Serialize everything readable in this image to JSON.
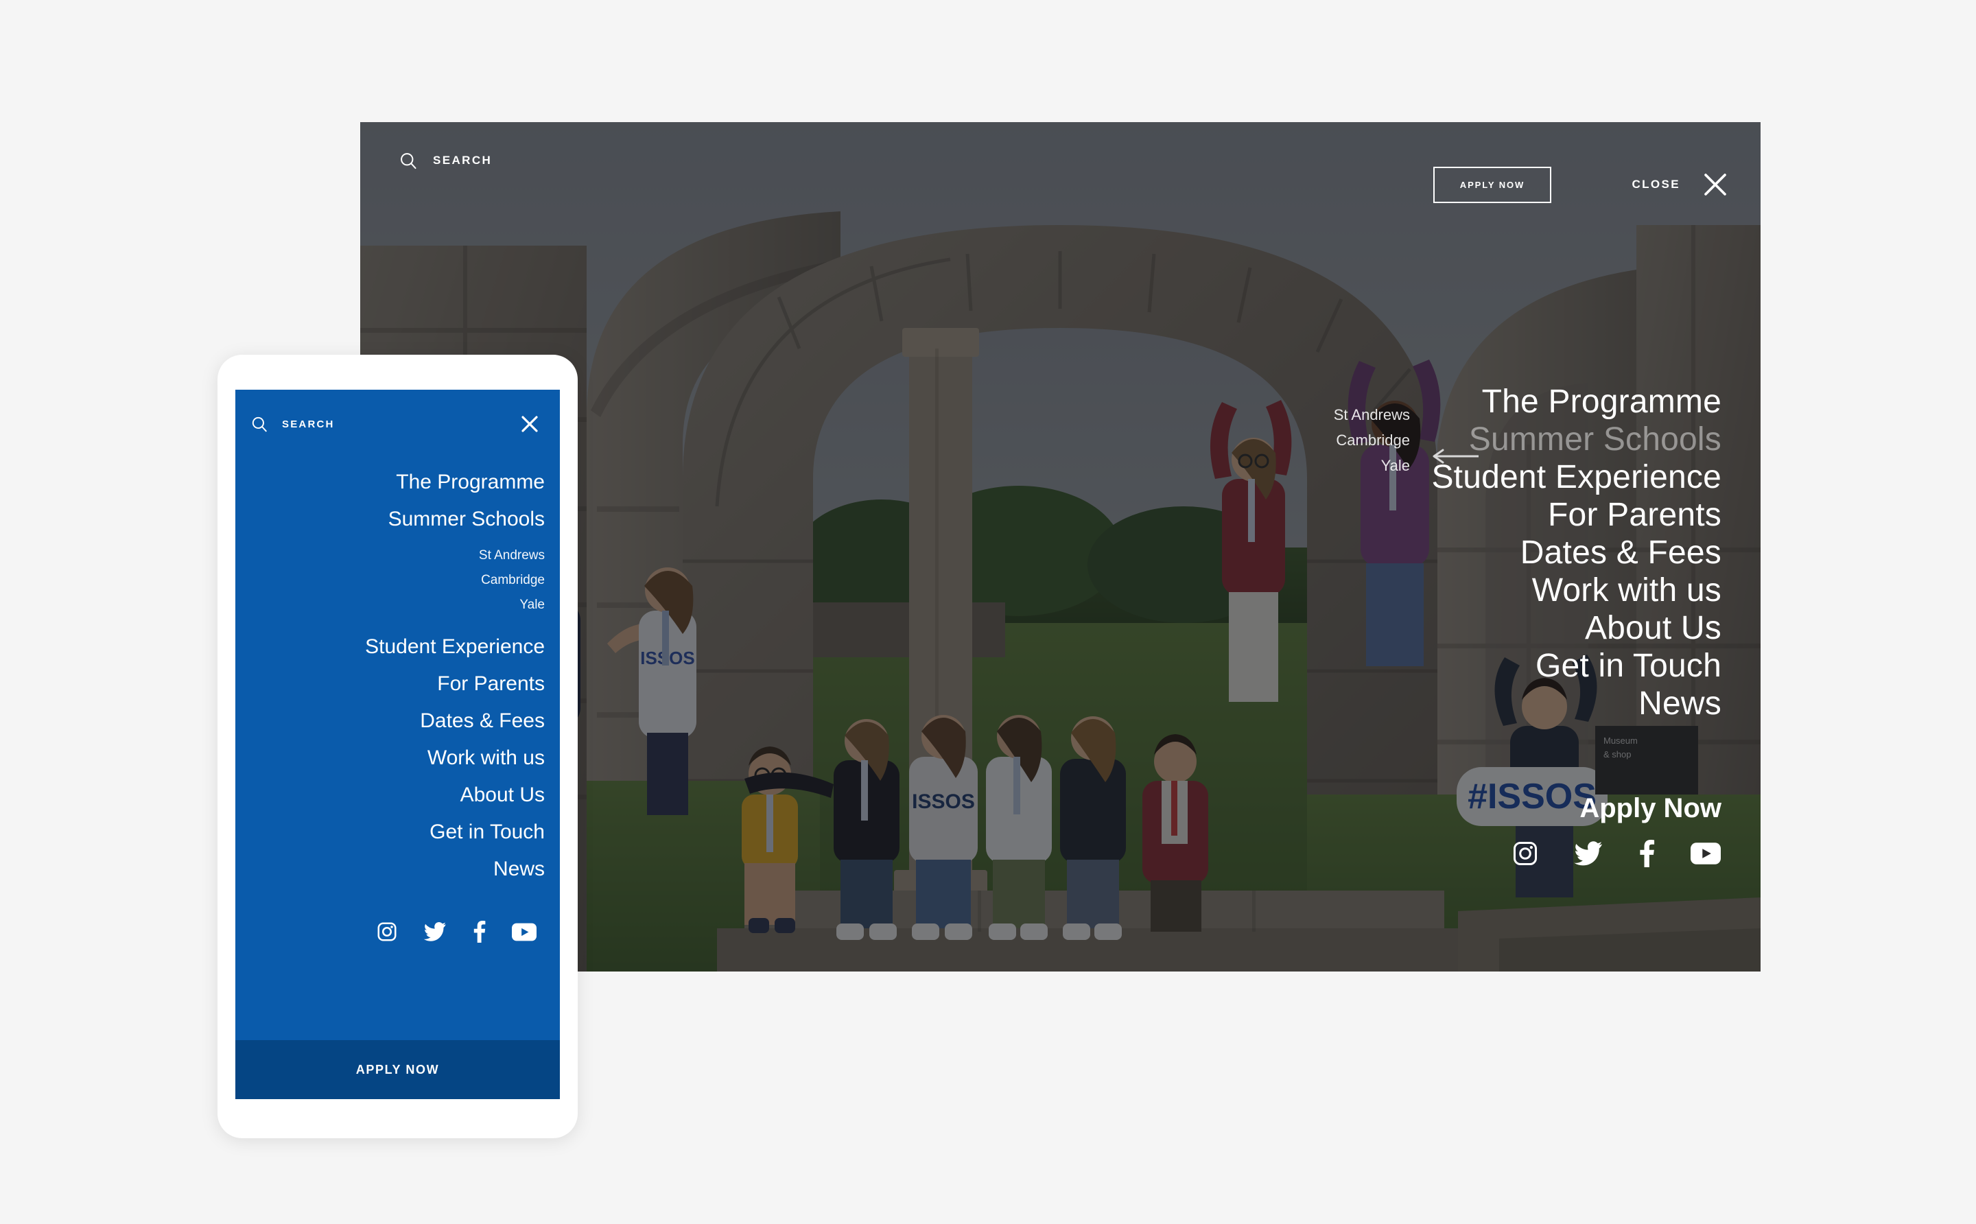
{
  "page": {
    "background_color": "#f5f5f5",
    "brand_blue": "#0a5bab",
    "brand_blue_dark": "#054584"
  },
  "desktop": {
    "search": {
      "label": "SEARCH",
      "icon": "search-icon"
    },
    "apply_button": {
      "label": "APPLY NOW"
    },
    "close": {
      "label": "CLOSE",
      "icon": "close-icon"
    },
    "nav_items": [
      {
        "label": "The Programme",
        "state": "normal"
      },
      {
        "label": "Summer Schools",
        "state": "dimmed"
      },
      {
        "label": "Student Experience",
        "state": "normal"
      },
      {
        "label": "For Parents",
        "state": "normal"
      },
      {
        "label": "Dates & Fees",
        "state": "normal"
      },
      {
        "label": "Work with us",
        "state": "normal"
      },
      {
        "label": "About Us",
        "state": "normal"
      },
      {
        "label": "Get in Touch",
        "state": "normal"
      },
      {
        "label": "News",
        "state": "normal"
      }
    ],
    "apply_link": {
      "label": "Apply Now"
    },
    "submenu": {
      "parent": "Summer Schools",
      "items": [
        {
          "label": "St Andrews"
        },
        {
          "label": "Cambridge",
          "active": true
        },
        {
          "label": "Yale"
        }
      ],
      "arrow_icon": "arrow-left-icon"
    },
    "social": [
      {
        "name": "instagram-icon",
        "label": "Instagram"
      },
      {
        "name": "twitter-icon",
        "label": "Twitter"
      },
      {
        "name": "facebook-icon",
        "label": "Facebook"
      },
      {
        "name": "youtube-icon",
        "label": "YouTube"
      }
    ],
    "photo": {
      "description": "Group of students with arms raised in front of stone cathedral ruins",
      "sign_text": "#ISSOS"
    }
  },
  "mobile": {
    "search": {
      "label": "SEARCH",
      "icon": "search-icon"
    },
    "close": {
      "icon": "close-icon"
    },
    "nav_items": [
      {
        "label": "The Programme"
      },
      {
        "label": "Summer Schools"
      },
      {
        "label": "Student Experience"
      },
      {
        "label": "For Parents"
      },
      {
        "label": "Dates & Fees"
      },
      {
        "label": "Work with us"
      },
      {
        "label": "About Us"
      },
      {
        "label": "Get in Touch"
      },
      {
        "label": "News"
      }
    ],
    "submenu": {
      "items": [
        {
          "label": "St Andrews"
        },
        {
          "label": "Cambridge"
        },
        {
          "label": "Yale"
        }
      ]
    },
    "social": [
      {
        "name": "instagram-icon",
        "label": "Instagram"
      },
      {
        "name": "twitter-icon",
        "label": "Twitter"
      },
      {
        "name": "facebook-icon",
        "label": "Facebook"
      },
      {
        "name": "youtube-icon",
        "label": "YouTube"
      }
    ],
    "apply_button": {
      "label": "APPLY NOW"
    }
  }
}
